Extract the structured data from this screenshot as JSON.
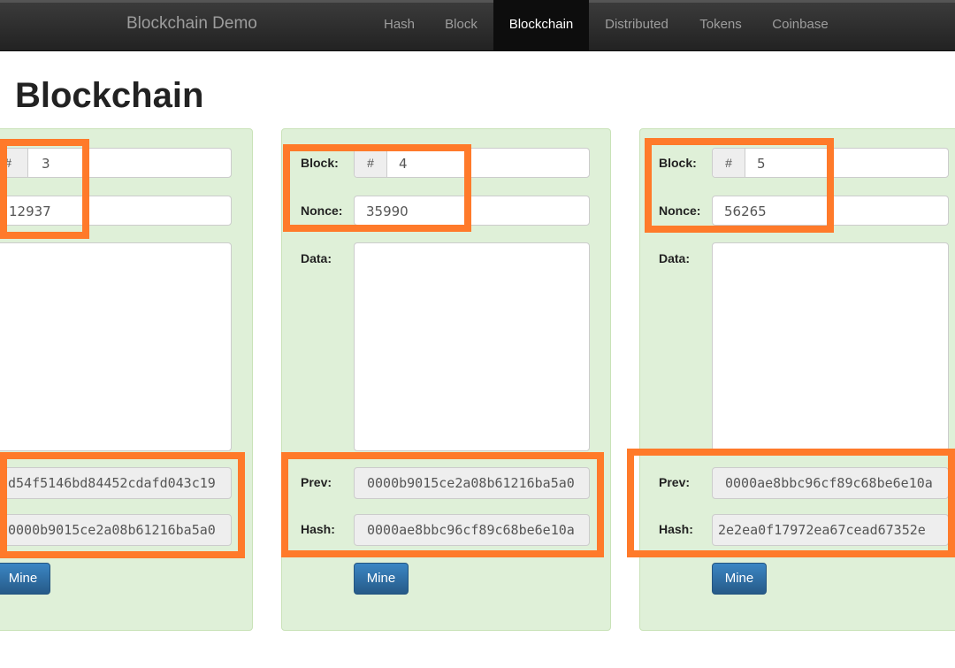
{
  "navbar": {
    "brand": "Blockchain Demo",
    "items": [
      "Hash",
      "Block",
      "Blockchain",
      "Distributed",
      "Tokens",
      "Coinbase"
    ],
    "active": "Blockchain"
  },
  "page_title": "Blockchain",
  "labels": {
    "block": "Block:",
    "nonce": "Nonce:",
    "data": "Data:",
    "prev": "Prev:",
    "hash": "Hash:",
    "hash_addon": "#",
    "mine": "Mine"
  },
  "blocks": [
    {
      "number": "3",
      "nonce": "12937",
      "data": "",
      "prev": "d54f5146bd84452cdafd043c19",
      "hash": "0000b9015ce2a08b61216ba5a0"
    },
    {
      "number": "4",
      "nonce": "35990",
      "data": "",
      "prev": "0000b9015ce2a08b61216ba5a0",
      "hash": "0000ae8bbc96cf89c68be6e10a"
    },
    {
      "number": "5",
      "nonce": "56265",
      "data": "",
      "prev": "0000ae8bbc96cf89c68be6e10a",
      "hash": "2e2ea0f17972ea67cead67352e"
    }
  ],
  "colors": {
    "highlight": "#ff7a2a",
    "card_bg": "#dff0d8",
    "button": "#337ab7"
  }
}
